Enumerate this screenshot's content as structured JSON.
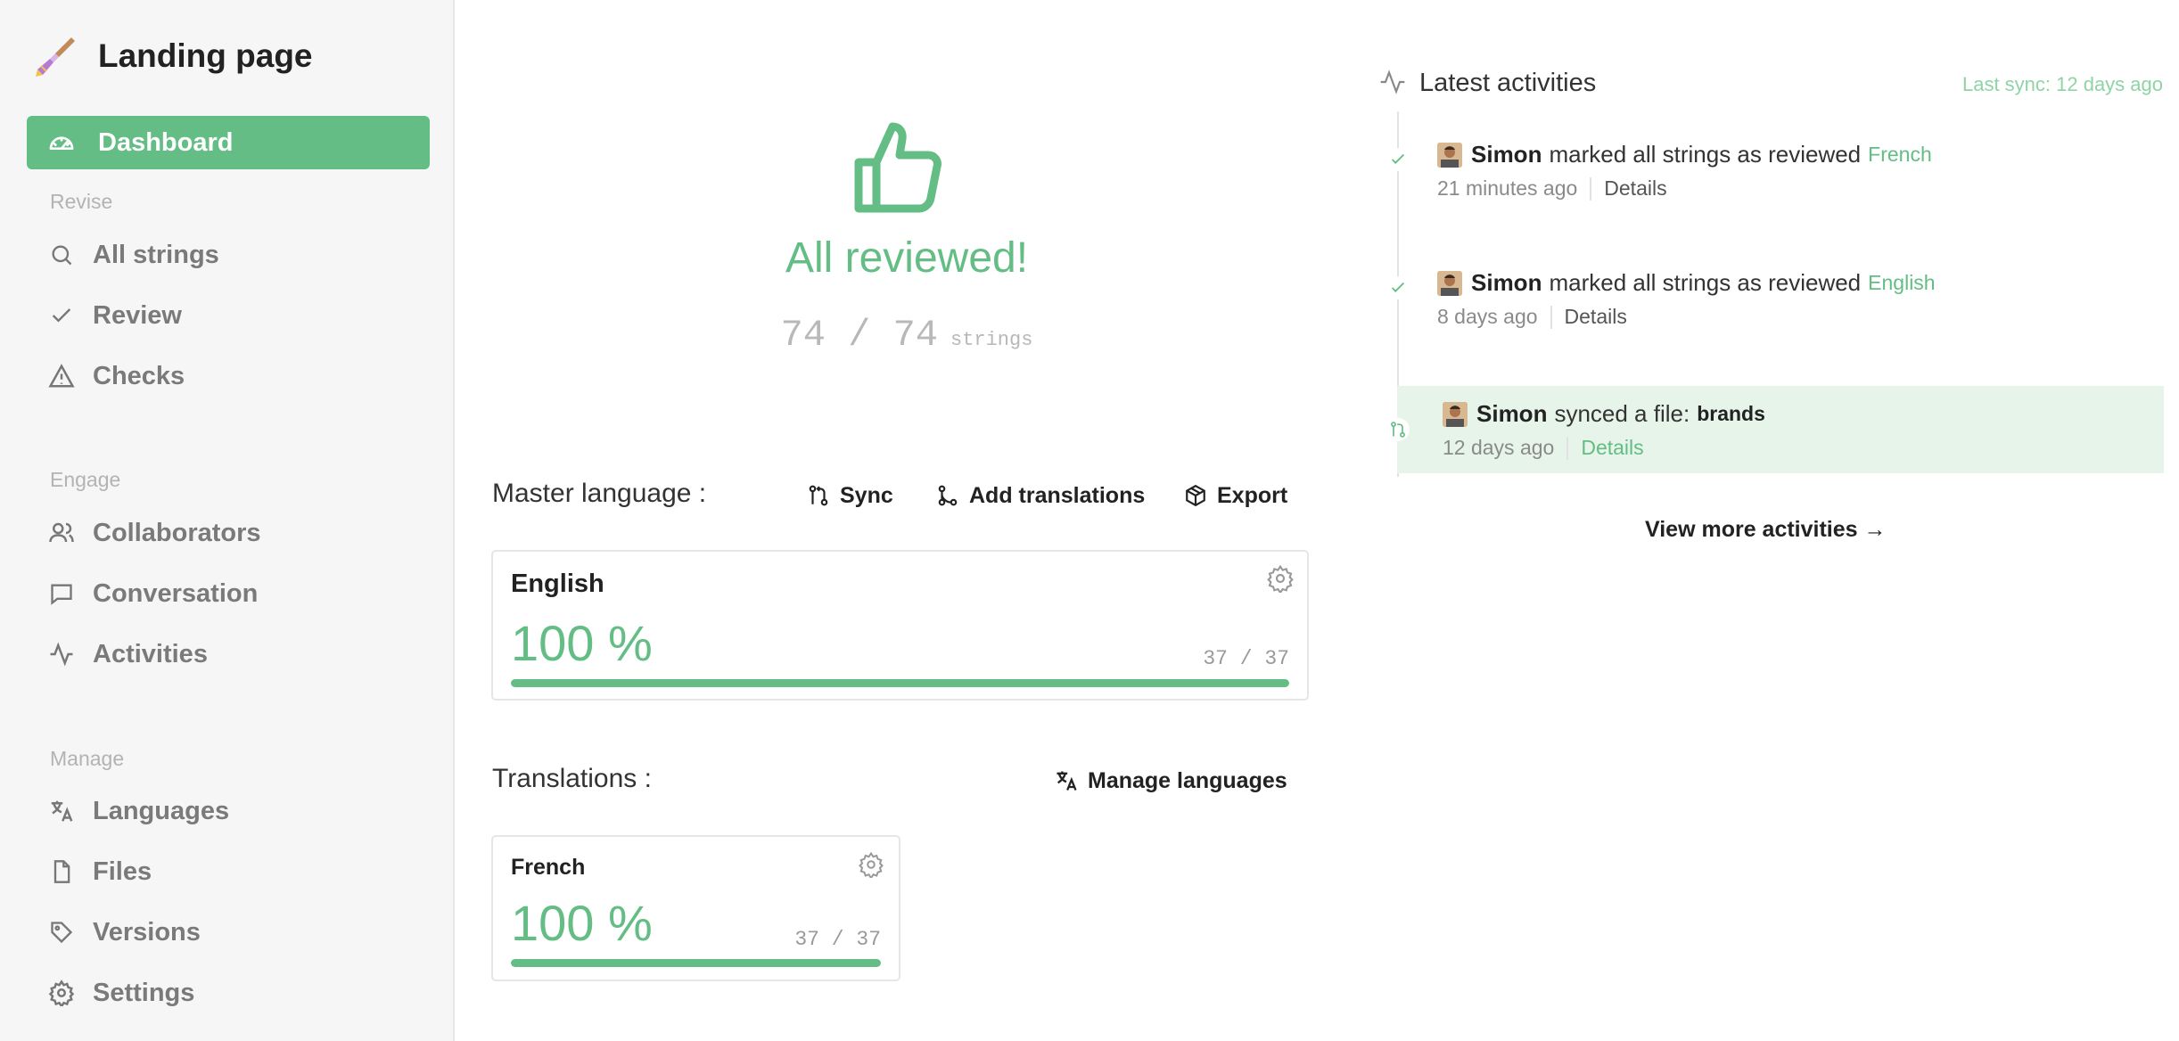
{
  "project": {
    "title": "Landing page"
  },
  "sidebar": {
    "active": {
      "label": "Dashboard",
      "icon": "dashboard-icon"
    },
    "sections": [
      {
        "title": "Revise",
        "items": [
          {
            "label": "All strings",
            "icon": "search-icon"
          },
          {
            "label": "Review",
            "icon": "check-icon"
          },
          {
            "label": "Checks",
            "icon": "warning-icon"
          }
        ]
      },
      {
        "title": "Engage",
        "items": [
          {
            "label": "Collaborators",
            "icon": "users-icon"
          },
          {
            "label": "Conversation",
            "icon": "chat-icon"
          },
          {
            "label": "Activities",
            "icon": "activity-icon"
          }
        ]
      },
      {
        "title": "Manage",
        "items": [
          {
            "label": "Languages",
            "icon": "translate-icon"
          },
          {
            "label": "Files",
            "icon": "file-icon"
          },
          {
            "label": "Versions",
            "icon": "tag-icon"
          },
          {
            "label": "Settings",
            "icon": "gear-icon"
          }
        ]
      }
    ]
  },
  "hero": {
    "title": "All reviewed!",
    "count": "74 / 74",
    "unit": "strings"
  },
  "master": {
    "label": "Master language :",
    "actions": {
      "sync": "Sync",
      "add": "Add translations",
      "export": "Export"
    },
    "card": {
      "name": "English",
      "percent": "100 %",
      "count": "37 / 37",
      "progress": 1.0
    }
  },
  "translations": {
    "label": "Translations :",
    "manage": "Manage languages",
    "cards": [
      {
        "name": "French",
        "percent": "100 %",
        "count": "37 / 37",
        "progress": 1.0
      }
    ]
  },
  "activities": {
    "title": "Latest activities",
    "last_sync": "Last sync: 12 days ago",
    "items": [
      {
        "user": "Simon",
        "text": "marked all strings as reviewed",
        "lang": "French",
        "time": "21 minutes ago",
        "details": "Details"
      },
      {
        "user": "Simon",
        "text": "marked all strings as reviewed",
        "lang": "English",
        "time": "8 days ago",
        "details": "Details"
      },
      {
        "user": "Simon",
        "text": "synced a file:",
        "file": "brands",
        "time": "12 days ago",
        "details": "Details"
      }
    ],
    "view_more": "View more activities →"
  },
  "colors": {
    "accent": "#63bd84",
    "highlight": "#e6f4ea"
  }
}
